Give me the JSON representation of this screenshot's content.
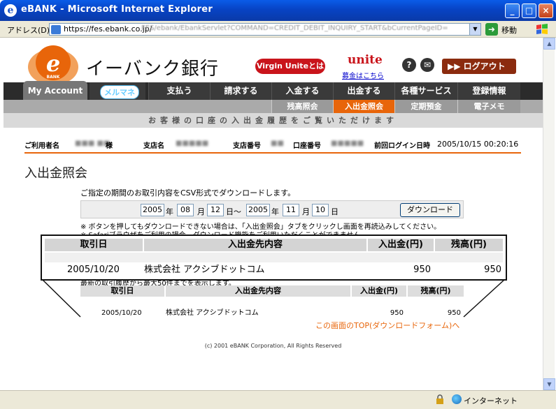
{
  "window": {
    "title": "eBANK - Microsoft Internet Explorer",
    "minimize": "_",
    "maximize": "□",
    "close": "×"
  },
  "address": {
    "label": "アドレス(D)",
    "url_visible": "https://fes.ebank.co.jp/",
    "url_rest": "FES/ebank/EbankServlet?COMMAND=CREDIT_DEBIT_INQUIRY_START&bCurrentPageID=",
    "go_label": "移動"
  },
  "status": {
    "zone": "インターネット"
  },
  "header": {
    "site_title": "イーバンク銀行",
    "virgin_button": "Virgin Uniteとは",
    "unite_logo": "unite",
    "unite_link": "募金はこちら",
    "help_icon": "?",
    "mail_icon": "✉",
    "logout_label": "ログアウト",
    "logout_arrow": "▶▶"
  },
  "nav": {
    "my_account": "My Account",
    "mail_logo": "メルマネ",
    "items": [
      "支払う",
      "請求する",
      "入金する",
      "出金する",
      "各種サービス",
      "登録情報"
    ]
  },
  "subnav": {
    "items": [
      "残高照会",
      "入出金照会",
      "定期預金",
      "電子メモ"
    ],
    "active_index": 1
  },
  "banner": "お客様の口座の入出金履歴をご覧いただけます",
  "info": {
    "user_label": "ご利用者名",
    "user_suffix": "様",
    "branch_label": "支店名",
    "branch_no_label": "支店番号",
    "account_no_label": "口座番号",
    "last_login_label": "前回ログイン日時",
    "last_login_value": "2005/10/15 00:20:16"
  },
  "page": {
    "heading": "入出金照会",
    "csv_desc": "ご指定の期間のお取引内容をCSV形式でダウンロードします。",
    "note1": "※ ボタンを押してもダウンロードできない場合は、「入出金照会」タブをクリックし画面を再読込みしてください。",
    "note2": "※ Safariブラウザをご利用の場合、ダウンロード機能をご利用いただくことができません。",
    "latest_note": "最新の取引履歴から最大50件までを表示します。",
    "top_link": "この画面のTOP(ダウンロードフォーム)へ",
    "footer": "(c) 2001 eBANK Corporation, All Rights Reserved"
  },
  "dateform": {
    "from_year": "2005",
    "from_month": "08",
    "from_day": "12",
    "to_year": "2005",
    "to_month": "11",
    "to_day": "10",
    "year_label": "年",
    "month_label": "月",
    "day_label": "日",
    "from_day_label": "日～",
    "download_button": "ダウンロード"
  },
  "table": {
    "headers": [
      "取引日",
      "入出金先内容",
      "入出金(円)",
      "残高(円)"
    ],
    "rows": [
      {
        "date": "2005/10/20",
        "desc": "株式会社 アクシブドットコム",
        "amount": "950",
        "balance": "950"
      }
    ]
  }
}
